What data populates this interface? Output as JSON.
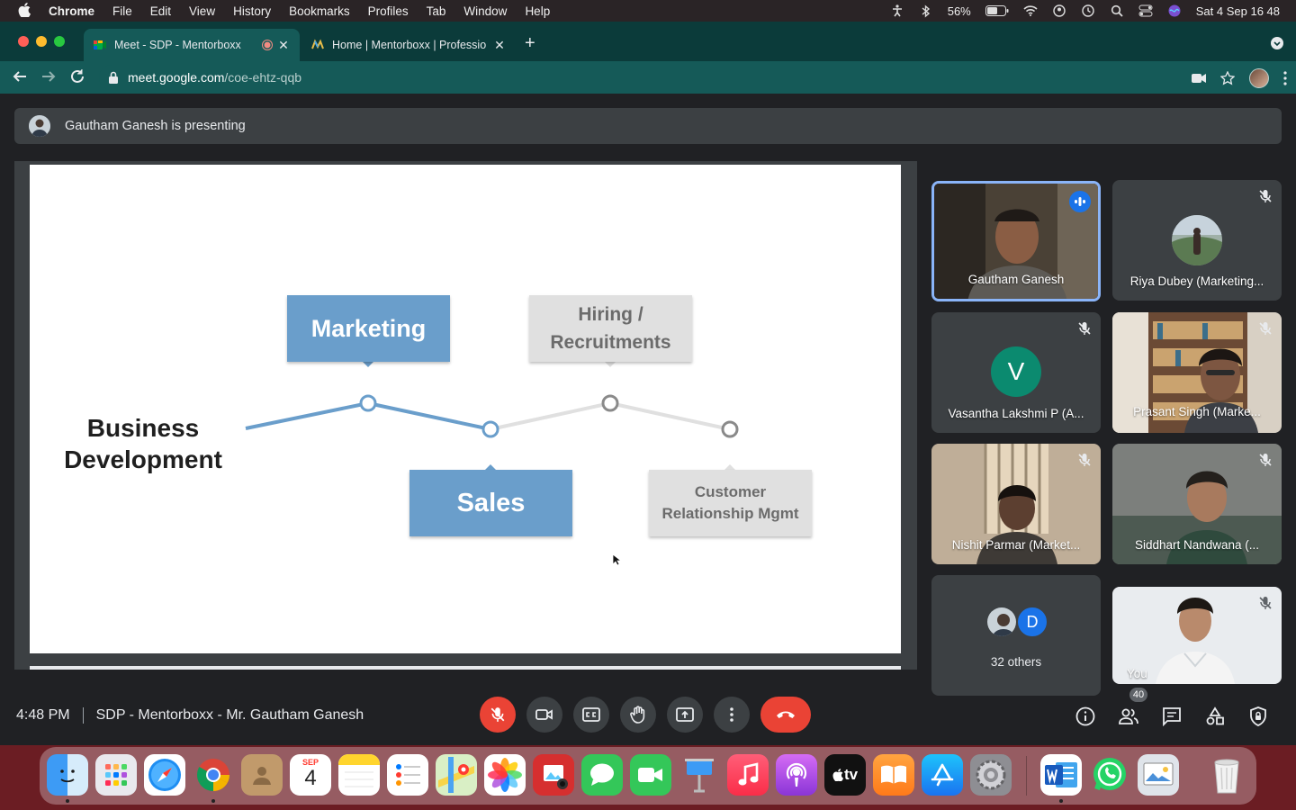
{
  "menubar": {
    "app": "Chrome",
    "items": [
      "File",
      "Edit",
      "View",
      "History",
      "Bookmarks",
      "Profiles",
      "Tab",
      "Window",
      "Help"
    ],
    "battery": "56%",
    "datetime": "Sat 4 Sep  16 48"
  },
  "browser": {
    "tabs": [
      {
        "title": "Meet - SDP - Mentorboxx",
        "active": true
      },
      {
        "title": "Home | Mentorboxx | Professio",
        "active": false
      }
    ],
    "url_host": "meet.google.com",
    "url_path": "/coe-ehtz-qqb"
  },
  "meet": {
    "presenting_banner": "Gautham Ganesh is presenting",
    "slide": {
      "title_line1": "Business",
      "title_line2": "Development",
      "marketing": "Marketing",
      "sales": "Sales",
      "hiring_line1": "Hiring /",
      "hiring_line2": "Recruitments",
      "crm_line1": "Customer",
      "crm_line2": "Relationship Mgmt"
    },
    "participants": [
      {
        "name": "Gautham Ganesh"
      },
      {
        "name": "Riya Dubey (Marketing..."
      },
      {
        "name": "Vasantha Lakshmi P (A...",
        "initial": "V"
      },
      {
        "name": "Prasant Singh (Marke..."
      },
      {
        "name": "Nishit Parmar (Market..."
      },
      {
        "name": "Siddhart Nandwana (..."
      },
      {
        "name": "32 others",
        "initial": "D"
      },
      {
        "name": "You"
      }
    ],
    "time": "4:48 PM",
    "meeting_title": "SDP - Mentorboxx - Mr. Gautham Ganesh",
    "participant_count": "40"
  },
  "dock": {
    "calendar_month": "SEP",
    "calendar_day": "4",
    "tv_label": "tv"
  },
  "colors": {
    "tab_strip": "#0b3b3a",
    "toolbar": "#155a58",
    "meet_bg": "#202124",
    "slide_blue": "#6a9ecb",
    "end_call": "#ea4335"
  }
}
